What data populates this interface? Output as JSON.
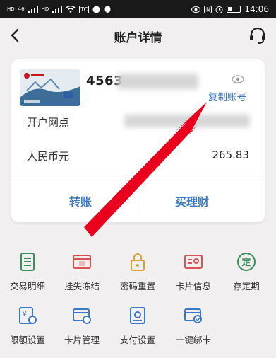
{
  "status_bar": {
    "left_badges": [
      "HD",
      "46",
      "HD"
    ],
    "time": "14:06",
    "app_badge": "TC"
  },
  "header": {
    "title": "账户详情",
    "back_icon": "chevron-left-icon",
    "service_icon": "headset-icon"
  },
  "card": {
    "account_prefix": "4563",
    "copy_label": "复制账号",
    "branch_label": "开户网点",
    "currency_label": "人民币元",
    "balance": "265.83",
    "transfer_label": "转账",
    "wealth_label": "买理财"
  },
  "services": [
    {
      "label": "交易明细",
      "icon": "transactions-icon",
      "color": "#3a8f5c"
    },
    {
      "label": "挂失冻结",
      "icon": "report-loss-icon",
      "color": "#d9534f"
    },
    {
      "label": "密码重置",
      "icon": "lock-reset-icon",
      "color": "#e0a030"
    },
    {
      "label": "卡片信息",
      "icon": "card-info-icon",
      "color": "#d9534f"
    },
    {
      "label": "存定期",
      "icon": "fixed-deposit-icon",
      "color": "#3a8f5c"
    },
    {
      "label": "限额设置",
      "icon": "limit-settings-icon",
      "color": "#3a79c8"
    },
    {
      "label": "卡片管理",
      "icon": "card-manage-icon",
      "color": "#3a79c8"
    },
    {
      "label": "支付设置",
      "icon": "payment-settings-icon",
      "color": "#3a79c8"
    },
    {
      "label": "一键绑卡",
      "icon": "bind-card-icon",
      "color": "#3a79c8"
    }
  ],
  "colors": {
    "accent": "#3a79c8",
    "arrow": "#e8001c",
    "background": "#f1eff0"
  }
}
